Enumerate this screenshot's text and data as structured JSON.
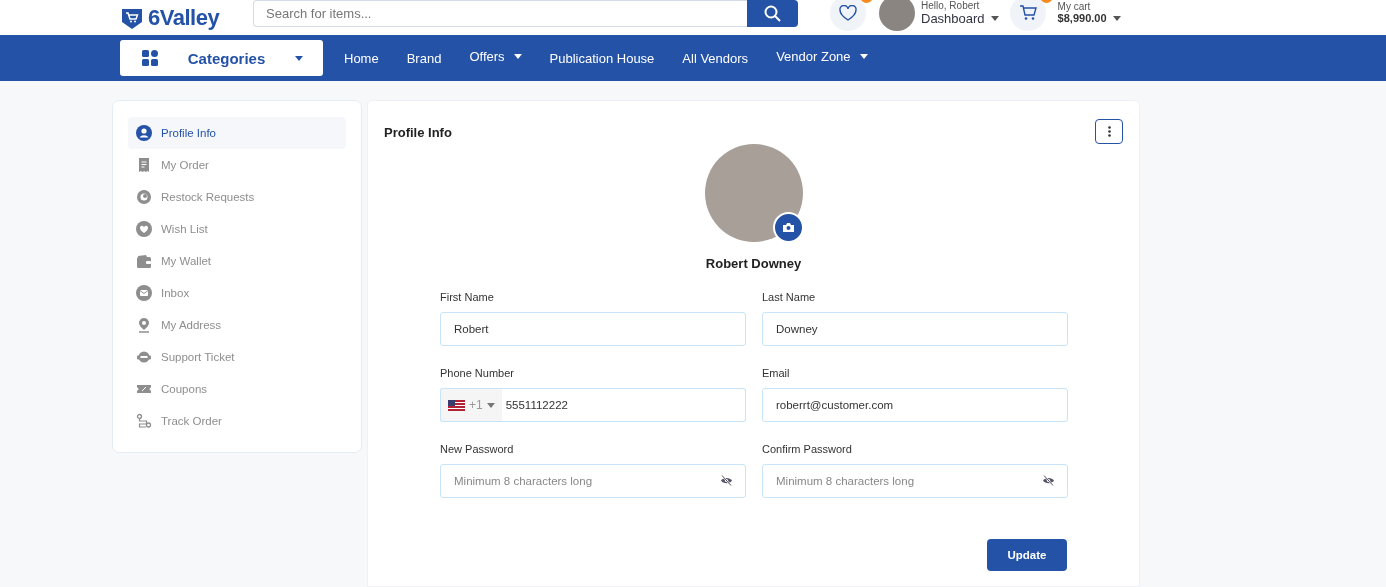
{
  "header": {
    "logo": "6Valley",
    "search": {
      "placeholder": "Search for items..."
    },
    "greeting": "Hello, Robert",
    "account": "Dashboard",
    "cart_label": "My cart",
    "cart_total": "$8,990.00"
  },
  "nav": {
    "categories": "Categories",
    "links": [
      {
        "label": "Home",
        "dropdown": false
      },
      {
        "label": "Brand",
        "dropdown": false
      },
      {
        "label": "Offers",
        "dropdown": true
      },
      {
        "label": "Publication House",
        "dropdown": false
      },
      {
        "label": "All Vendors",
        "dropdown": false
      },
      {
        "label": "Vendor Zone",
        "dropdown": true
      }
    ]
  },
  "sidebar": {
    "items": [
      {
        "label": "Profile Info",
        "selected": true
      },
      {
        "label": "My Order",
        "selected": false
      },
      {
        "label": "Restock Requests",
        "selected": false
      },
      {
        "label": "Wish List",
        "selected": false
      },
      {
        "label": "My Wallet",
        "selected": false
      },
      {
        "label": "Inbox",
        "selected": false
      },
      {
        "label": "My Address",
        "selected": false
      },
      {
        "label": "Support Ticket",
        "selected": false
      },
      {
        "label": "Coupons",
        "selected": false
      },
      {
        "label": "Track Order",
        "selected": false
      }
    ]
  },
  "profile": {
    "title": "Profile Info",
    "name": "Robert Downey",
    "fields": [
      {
        "kind": "text",
        "label": "First Name",
        "value": "Robert"
      },
      {
        "kind": "text",
        "label": "Last Name",
        "value": "Downey"
      },
      {
        "kind": "phone",
        "label": "Phone Number",
        "code": "+1",
        "value": "5551112222"
      },
      {
        "kind": "text",
        "label": "Email",
        "value": "roberrt@customer.com"
      },
      {
        "kind": "password",
        "label": "New Password",
        "placeholder": "Minimum 8 characters long"
      },
      {
        "kind": "password",
        "label": "Confirm Password",
        "placeholder": "Minimum 8 characters long"
      }
    ],
    "button": "Update"
  }
}
